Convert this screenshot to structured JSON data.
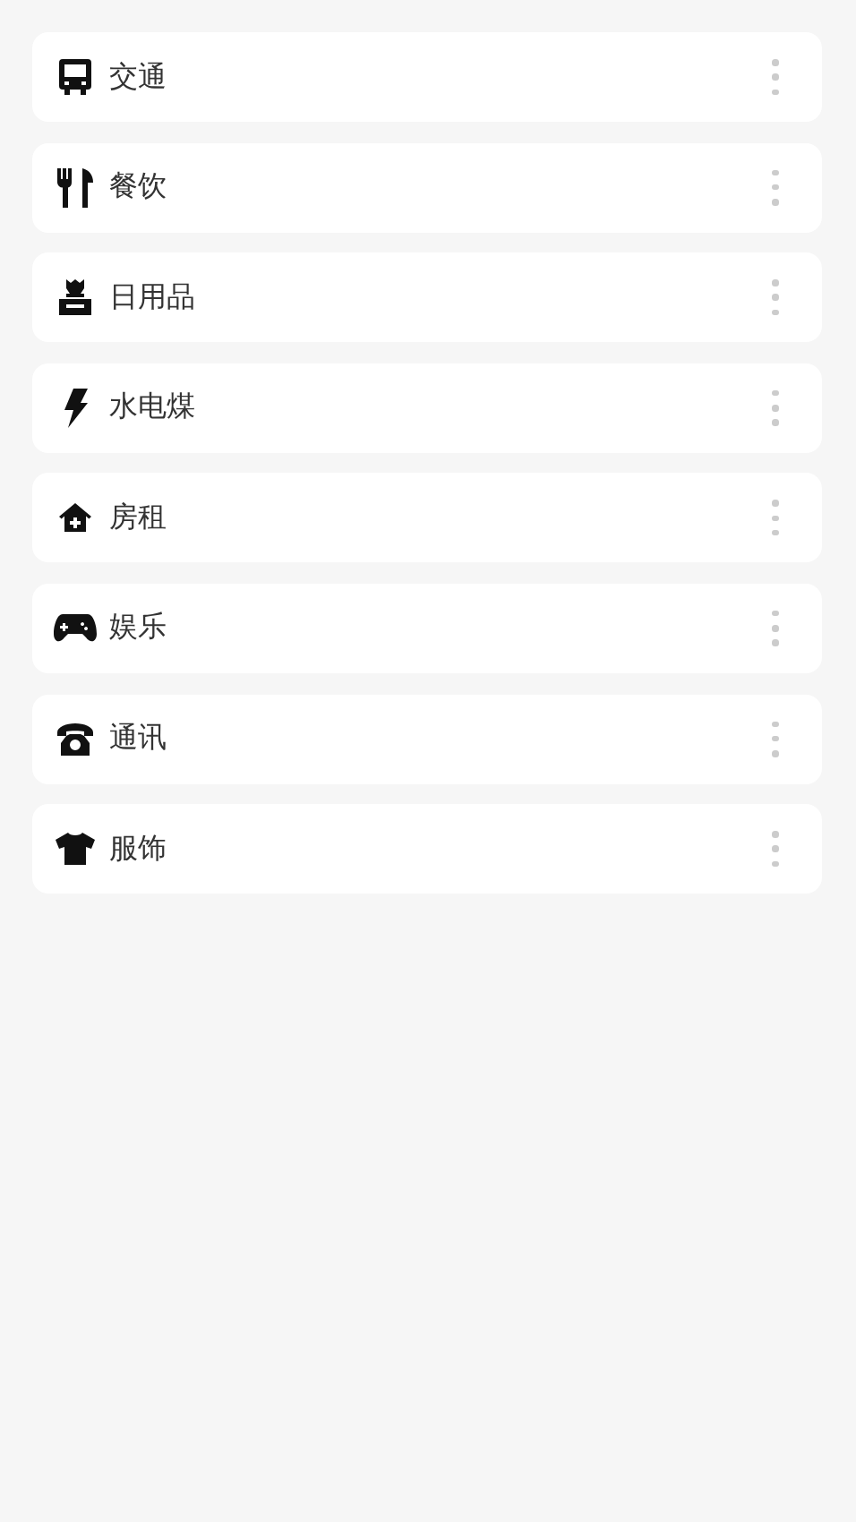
{
  "categories": [
    {
      "label": "交通"
    },
    {
      "label": "餐饮"
    },
    {
      "label": "日用品"
    },
    {
      "label": "水电煤"
    },
    {
      "label": "房租"
    },
    {
      "label": "娱乐"
    },
    {
      "label": "通讯"
    },
    {
      "label": "服饰"
    }
  ]
}
